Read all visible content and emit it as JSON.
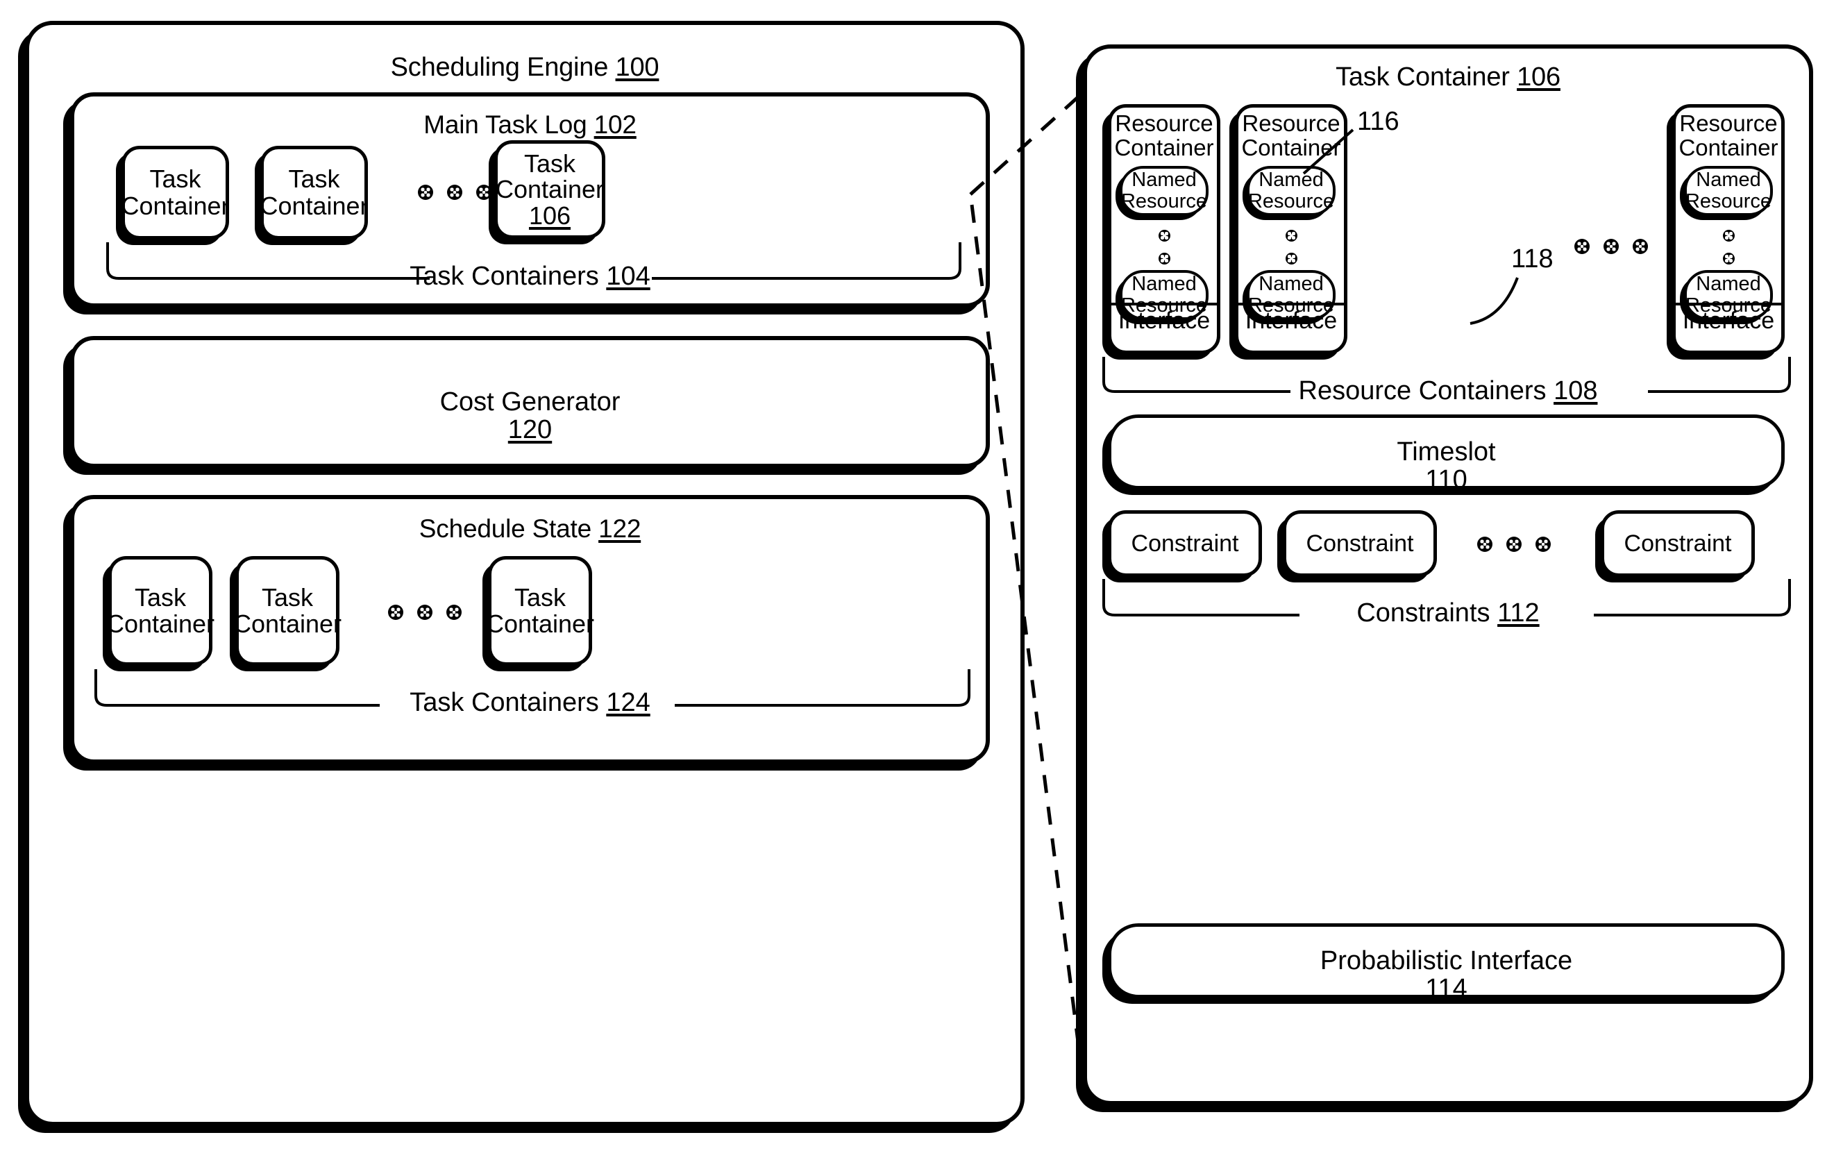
{
  "figure": {
    "style": "patent-line-drawing",
    "stroke_color": "#000000",
    "background_color": "#ffffff"
  },
  "left_panel": {
    "title_text": "Scheduling Engine",
    "title_ref": "100",
    "main_task_log": {
      "title_text": "Main Task Log",
      "title_ref": "102",
      "items": [
        {
          "label": "Task\nContainer",
          "ref": ""
        },
        {
          "label": "Task\nContainer",
          "ref": ""
        },
        {
          "label": "Task\nContainer",
          "ref": "106"
        }
      ],
      "ellipsis": "•••",
      "group_label": "Task Containers",
      "group_ref": "104"
    },
    "cost_generator": {
      "title_text": "Cost Generator",
      "title_ref": "120"
    },
    "schedule_state": {
      "title_text": "Schedule State",
      "title_ref": "122",
      "items": [
        {
          "label": "Task\nContainer",
          "ref": ""
        },
        {
          "label": "Task\nContainer",
          "ref": ""
        },
        {
          "label": "Task\nContainer",
          "ref": ""
        }
      ],
      "ellipsis": "•••",
      "group_label": "Task Containers",
      "group_ref": "124"
    }
  },
  "right_panel": {
    "title_text": "Task Container",
    "title_ref": "106",
    "resource_containers": [
      {
        "label": "Resource\nContainer",
        "named_resource_top": "Named\nResource",
        "named_resource_bottom": "Named\nResource",
        "interface_label": "Interface"
      },
      {
        "label": "Resource\nContainer",
        "named_resource_top": "Named\nResource",
        "named_resource_bottom": "Named\nResource",
        "interface_label": "Interface"
      },
      {
        "label": "Resource\nContainer",
        "named_resource_top": "Named\nResource",
        "named_resource_bottom": "Named\nResource",
        "interface_label": "Interface"
      }
    ],
    "resource_group_label": "Resource Containers",
    "resource_group_ref": "108",
    "callout_named_resource_ref": "116",
    "callout_interface_ref": "118",
    "timeslot": {
      "title_text": "Timeslot",
      "title_ref": "110"
    },
    "constraints": {
      "items": [
        "Constraint",
        "Constraint",
        "Constraint"
      ],
      "ellipsis": "•••",
      "group_label": "Constraints",
      "group_ref": "112"
    },
    "probabilistic_interface": {
      "title_text": "Probabilistic Interface",
      "title_ref": "114"
    }
  }
}
